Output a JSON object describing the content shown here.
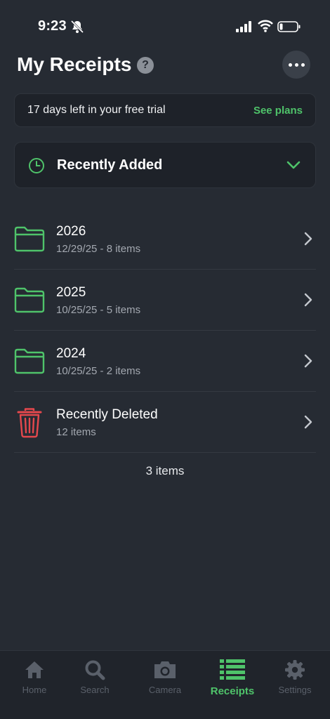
{
  "status_bar": {
    "time": "9:23"
  },
  "header": {
    "title": "My Receipts",
    "help": "?"
  },
  "trial_banner": {
    "text": "17 days left in your free trial",
    "action": "See plans"
  },
  "sort": {
    "label": "Recently Added"
  },
  "folders": [
    {
      "name": "2026",
      "meta": "12/29/25 - 8 items",
      "icon": "folder-icon"
    },
    {
      "name": "2025",
      "meta": "10/25/25 - 5 items",
      "icon": "folder-icon"
    },
    {
      "name": "2024",
      "meta": "10/25/25 - 2 items",
      "icon": "folder-icon"
    },
    {
      "name": "Recently Deleted",
      "meta": "12 items",
      "icon": "trash-icon"
    }
  ],
  "items_count": "3 items",
  "tabs": [
    {
      "label": "Home",
      "icon": "home-icon"
    },
    {
      "label": "Search",
      "icon": "search-icon"
    },
    {
      "label": "Camera",
      "icon": "camera-icon"
    },
    {
      "label": "Receipts",
      "icon": "list-icon",
      "active": true
    },
    {
      "label": "Settings",
      "icon": "gear-icon"
    }
  ],
  "colors": {
    "accent": "#4fc36a",
    "danger": "#e5484d",
    "background": "#262b33",
    "card": "#1e2229"
  }
}
